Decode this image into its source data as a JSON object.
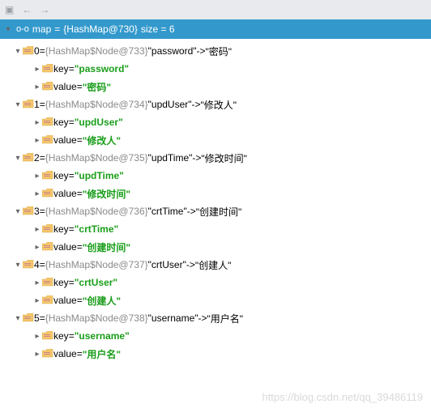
{
  "toolbar": {
    "back_icon": "←",
    "forward_icon": "→",
    "console_icon": "▣"
  },
  "header": {
    "expand_icon": "▾",
    "glasses_icon": "o-o",
    "var": "map",
    "eq": " = ",
    "type": "{HashMap@730}",
    "size_label": "  size = 6"
  },
  "entries": [
    {
      "index": "0",
      "node": "{HashMap$Node@733}",
      "key": "password",
      "value": "密码"
    },
    {
      "index": "1",
      "node": "{HashMap$Node@734}",
      "key": "updUser",
      "value": "修改人"
    },
    {
      "index": "2",
      "node": "{HashMap$Node@735}",
      "key": "updTime",
      "value": "修改时间"
    },
    {
      "index": "3",
      "node": "{HashMap$Node@736}",
      "key": "crtTime",
      "value": "创建时间"
    },
    {
      "index": "4",
      "node": "{HashMap$Node@737}",
      "key": "crtUser",
      "value": "创建人"
    },
    {
      "index": "5",
      "node": "{HashMap$Node@738}",
      "key": "username",
      "value": "用户名"
    }
  ],
  "labels": {
    "key": "key",
    "value": "value",
    "eq_sym": " = ",
    "arrow": " -> "
  },
  "watermark": "https://blog.csdn.net/qq_39486119"
}
